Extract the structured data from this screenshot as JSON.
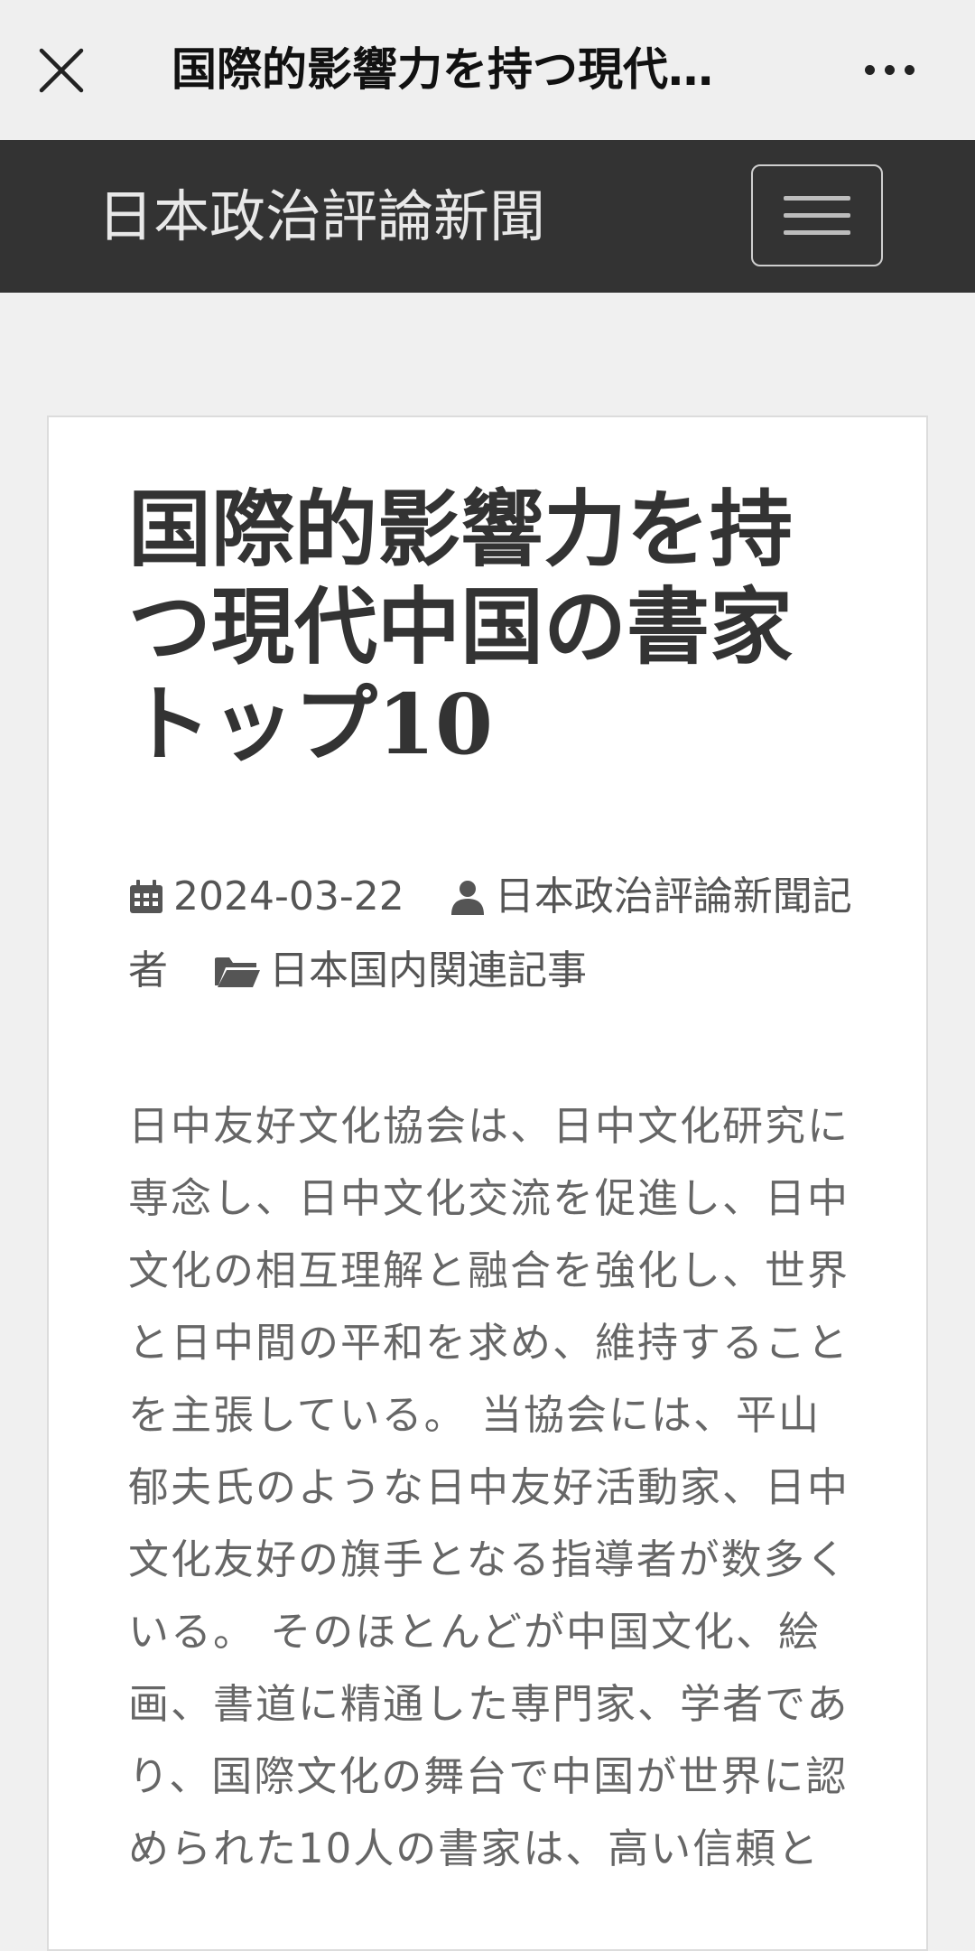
{
  "window": {
    "title": "国際的影響力を持つ現代…"
  },
  "site": {
    "name": "日本政治評論新聞"
  },
  "article": {
    "title": "国際的影響力を持つ現代中国の書家トップ10",
    "date": "2024-03-22",
    "author": "日本政治評論新聞記者",
    "category": "日本国内関連記事",
    "body": "日中友好文化協会は、日中文化研究に専念し、日中文化交流を促進し、日中文化の相互理解と融合を強化し、世界と日中間の平和を求め、維持することを主張している。 当協会には、平山郁夫氏のような日中友好活動家、日中文化友好の旗手となる指導者が数多くいる。 そのほとんどが中国文化、絵画、書道に精通した専門家、学者であり、国際文化の舞台で中国が世界に認められた10人の書家は、高い信頼と"
  },
  "icons": {
    "close": "close-icon",
    "more": "more-icon",
    "menu": "hamburger-icon",
    "date": "calendar-icon",
    "author": "user-icon",
    "category": "folder-icon"
  }
}
